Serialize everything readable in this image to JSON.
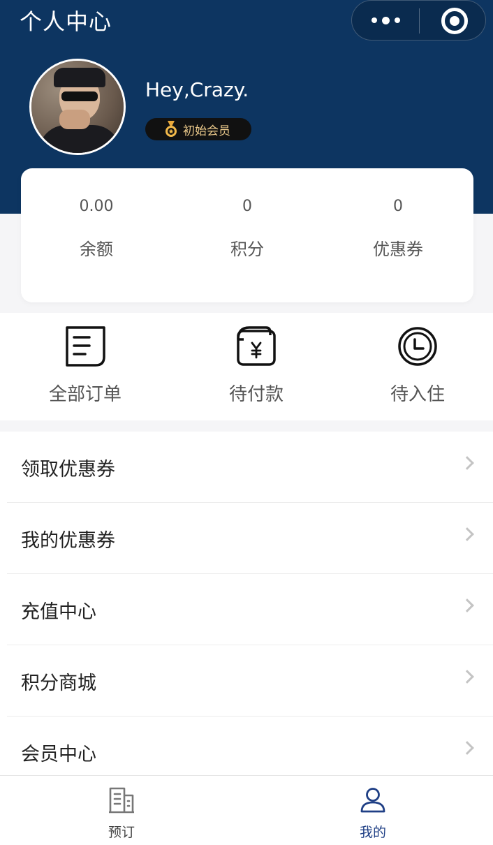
{
  "nav": {
    "title": "个人中心"
  },
  "profile": {
    "greeting": "Hey,Crazy.",
    "member_level": "初始会员"
  },
  "stats": [
    {
      "value": "0.00",
      "label": "余额"
    },
    {
      "value": "0",
      "label": "积分"
    },
    {
      "value": "0",
      "label": "优惠券"
    }
  ],
  "orders": [
    {
      "label": "全部订单",
      "icon": "order-list-icon"
    },
    {
      "label": "待付款",
      "icon": "wallet-yen-icon"
    },
    {
      "label": "待入住",
      "icon": "clock-icon"
    }
  ],
  "menu": [
    {
      "label": "领取优惠券"
    },
    {
      "label": "我的优惠券"
    },
    {
      "label": "充值中心"
    },
    {
      "label": "积分商城"
    },
    {
      "label": "会员中心"
    }
  ],
  "tabbar": [
    {
      "label": "预订",
      "icon": "building-icon",
      "active": false
    },
    {
      "label": "我的",
      "icon": "user-icon",
      "active": true
    }
  ],
  "colors": {
    "header_bg": "#0d3561",
    "tab_active": "#1f3f85",
    "tab_inactive": "#444444",
    "badge_text": "#e9c88a"
  }
}
